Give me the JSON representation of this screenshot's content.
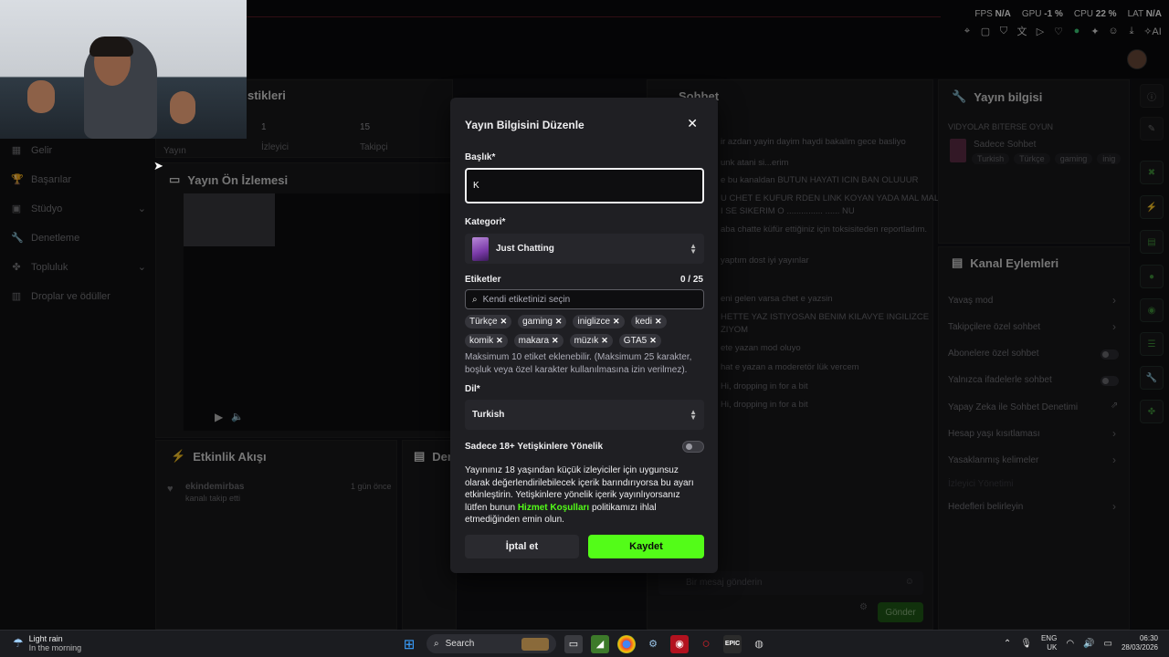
{
  "overlay": {
    "fps_label": "FPS",
    "fps_value": "N/A",
    "gpu_label": "GPU",
    "gpu_value": "-1 %",
    "cpu_label": "CPU",
    "cpu_value": "22 %",
    "lat_label": "LAT",
    "lat_value": "N/A",
    "ai_label": "AI"
  },
  "background": {
    "stats_title": "stikleri",
    "stat1_value": "1",
    "stat1_label": "İzleyici",
    "stat2_value": "15",
    "stat2_label": "Takipçi",
    "stat0_label": "Yayın",
    "preview_title": "Yayın Ön İzlemesi",
    "activity_title": "Etkinlik Akışı",
    "activity_user": "ekindemirbas",
    "activity_text": "kanalı takip etti",
    "activity_time": "1 gün önce",
    "de_title": "Den",
    "chat_title": "Sohbet",
    "chat_lines": [
      "ir azdan yayin dayim haydi bakalim gece basliyo",
      "unk atani si...erim",
      "e bu kanaldan BUTUN HAYATI ICIN BAN OLUUUR",
      "U CHET E KUFUR RDEN LINK KOYAN YADA MAL MAL",
      "I SE SIKERIM O ............... ...... NU",
      "aba chatte küfür ettiğiniz için toksisiteden reportladım.",
      "yaptım dost iyi yayınlar",
      "eni gelen varsa chet e yazsin",
      "HETTE YAZ ISTIYOSAN BENIM KILAVYE INGILIZCE",
      "ZIYOM",
      "ete yazan mod oluyo",
      "hat e yazan a moderetör lük vercem",
      "Hi, dropping in for a bit",
      "Hi, dropping in for a bit"
    ],
    "chat_placeholder": "Bir mesaj gönderin",
    "send_label": "Gönder",
    "info_title": "Yayın bilgisi",
    "info_stream_title": "VIDYOLAR BITERSE OYUN",
    "info_category": "Sadece Sohbet",
    "info_tags": [
      "Turkish",
      "Türkçe",
      "gaming",
      "inig"
    ],
    "channel_actions_title": "Kanal Eylemleri",
    "channel_actions": [
      "Yavaş mod",
      "Takipçilere özel sohbet",
      "Abonelere özel sohbet",
      "Yalnızca ifadelerle sohbet",
      "Yapay Zeka ile Sohbet Denetimi",
      "Hesap yaşı kısıtlaması",
      "Yasaklanmış kelimeler",
      "İzleyici Yönetimi",
      "Hedefleri belirleyin"
    ]
  },
  "sidebar": {
    "items": [
      {
        "label": "Gelir",
        "icon": "revenue-icon"
      },
      {
        "label": "Başarılar",
        "icon": "trophy-icon"
      },
      {
        "label": "Stüdyo",
        "icon": "studio-icon"
      },
      {
        "label": "Denetleme",
        "icon": "wrench-icon"
      },
      {
        "label": "Topluluk",
        "icon": "community-icon"
      },
      {
        "label": "Droplar ve ödüller",
        "icon": "gift-icon"
      }
    ]
  },
  "modal": {
    "title": "Yayın Bilgisini Düzenle",
    "title_label": "Başlık*",
    "title_value": "K",
    "category_label": "Kategori*",
    "category_value": "Just Chatting",
    "tags_label": "Etiketler",
    "tags_count": "0 / 25",
    "tags_placeholder": "Kendi etiketinizi seçin",
    "tags": [
      "Türkçe",
      "gaming",
      "iniglizce",
      "kedi",
      "komik",
      "makara",
      "müzık",
      "GTA5"
    ],
    "tags_hint": "Maksimum 10 etiket eklenebilir. (Maksimum 25 karakter, boşluk veya özel karakter kullanılmasına izin verilmez).",
    "language_label": "Dil*",
    "language_value": "Turkish",
    "adult_label": "Sadece 18+ Yetişkinlere Yönelik",
    "adult_enabled": false,
    "adult_desc_part1": "Yayınınız 18 yaşından küçük izleyiciler için uygunsuz olarak değerlendirilebilecek içerik barındırıyorsa bu ayarı etkinleştirin. Yetişkinlere yönelik içerik yayınlıyorsanız lütfen bunun ",
    "adult_desc_link": "Hizmet Koşulları",
    "adult_desc_part2": " politikamızı ihlal etmediğinden emin olun.",
    "cancel_label": "İptal et",
    "save_label": "Kaydet",
    "accent_color": "#53fc18"
  },
  "taskbar": {
    "weather_title": "Light rain",
    "weather_sub": "In the morning",
    "search_label": "Search",
    "lang_line1": "ENG",
    "lang_line2": "UK",
    "time": "06:30",
    "date": "28/03/2026"
  }
}
